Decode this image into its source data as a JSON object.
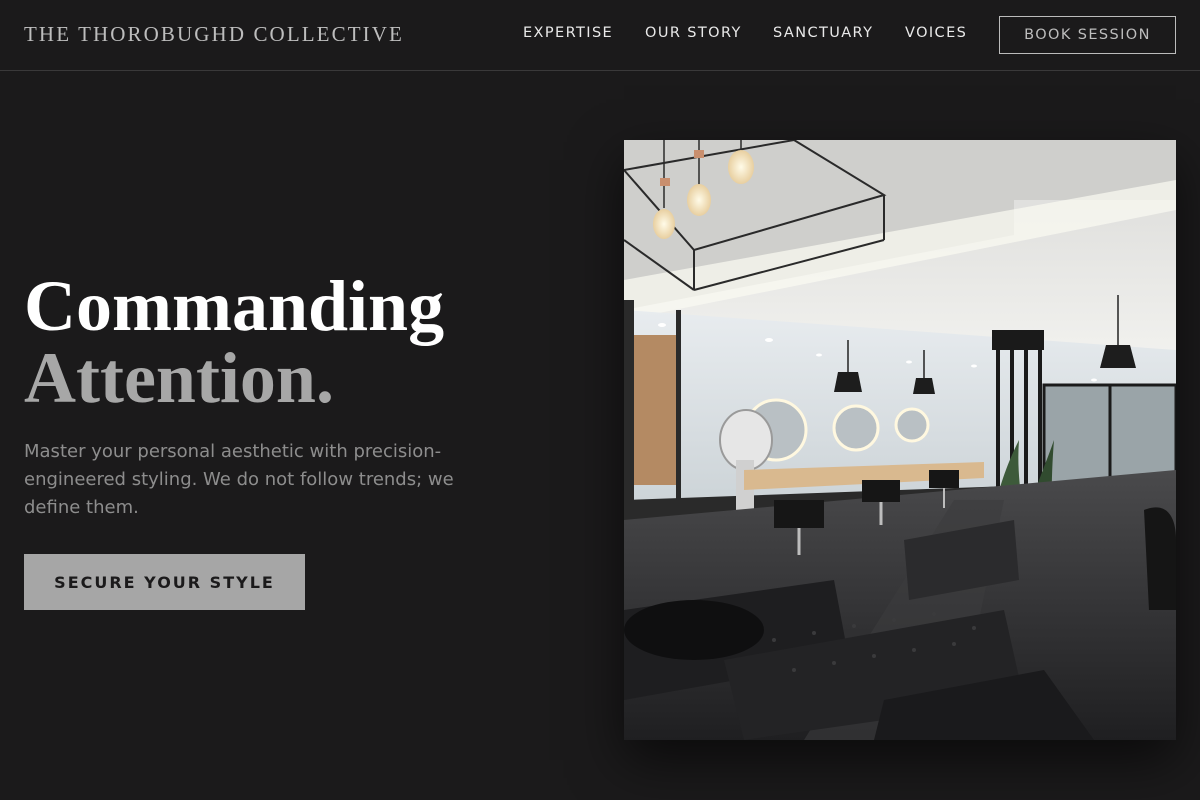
{
  "brand": {
    "name": "THE THOROBUGHD COLLECTIVE"
  },
  "nav": {
    "links": [
      "EXPERTISE",
      "OUR STORY",
      "SANCTUARY",
      "VOICES"
    ],
    "cta_label": "BOOK SESSION"
  },
  "hero": {
    "title_line_1": "Commanding",
    "title_line_2": "Attention.",
    "subtitle": "Master your personal aesthetic with precision-engineered styling. We do not follow trends; we define them.",
    "cta_label": "SECURE YOUR STYLE",
    "image": {
      "depicts": "salon-interior-photo"
    }
  },
  "colors": {
    "background": "#1b1a1b",
    "cta_background": "#a6a6a6",
    "muted_text": "#8d8d8d",
    "title_secondary": "#a7a7a7"
  }
}
